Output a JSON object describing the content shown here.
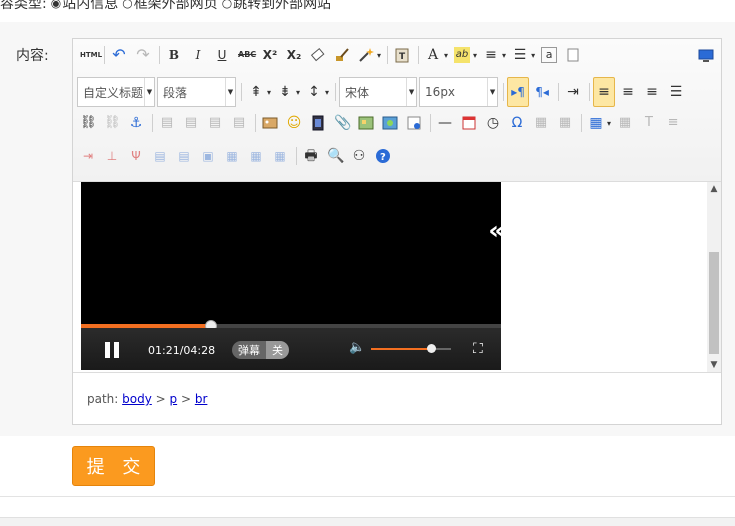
{
  "type_row": {
    "label": "容类型:",
    "options": [
      {
        "label": "站内信息",
        "selected": true
      },
      {
        "label": "框架外部网页",
        "selected": false
      },
      {
        "label": "跳转到外部网站",
        "selected": false
      }
    ]
  },
  "content_label": "内容:",
  "toolbar": {
    "row1": [
      {
        "name": "source-html-button",
        "icon": "HTML"
      },
      {
        "name": "undo-button",
        "icon": "↶"
      },
      {
        "name": "redo-button",
        "icon": "↷",
        "dim": true
      },
      {
        "name": "bold-button",
        "icon": "B"
      },
      {
        "name": "italic-button",
        "icon": "I"
      },
      {
        "name": "underline-button",
        "icon": "U"
      },
      {
        "name": "strikethrough-button",
        "icon": "ABC"
      },
      {
        "name": "superscript-button",
        "icon": "X²"
      },
      {
        "name": "subscript-button",
        "icon": "X₂"
      },
      {
        "name": "eraser-button",
        "icon": "⌫"
      },
      {
        "name": "format-brush-button",
        "icon": "🖌"
      },
      {
        "name": "auto-format-button",
        "icon": "✦"
      },
      {
        "name": "paste-plain-button",
        "icon": "▣"
      },
      {
        "name": "font-color-button",
        "icon": "A"
      },
      {
        "name": "highlight-color-button",
        "icon": "ab"
      },
      {
        "name": "ordered-list-button",
        "icon": "≡"
      },
      {
        "name": "unordered-list-button",
        "icon": "☰"
      },
      {
        "name": "select-all-button",
        "icon": "a"
      },
      {
        "name": "clear-doc-button",
        "icon": "▢"
      },
      {
        "name": "preview-button",
        "icon": "▭"
      }
    ],
    "row2": {
      "custom_title": "自定义标题",
      "paragraph": "段落",
      "font_family": "宋体",
      "font_size": "16px"
    },
    "row3": [
      "link",
      "unlink",
      "anchor",
      "image-none",
      "image-left",
      "image-right",
      "image-center",
      "simple-upload",
      "emotion",
      "insert-video",
      "attachment",
      "map",
      "gmap",
      "insert-frame",
      "horizontal-rule",
      "date",
      "time",
      "special-char",
      "snapscreen",
      "wordimage",
      "insert-table",
      "delete-table",
      "insert-paragraph-before-table"
    ],
    "row4": [
      "insert-row",
      "delete-row",
      "insert-col",
      "delete-col",
      "merge-cells",
      "merge-right",
      "merge-down",
      "split-cells",
      "split-rows",
      "split-cols",
      "print",
      "search-replace",
      "template",
      "help"
    ]
  },
  "video": {
    "time": "01:21/04:28",
    "progress": 0.31,
    "volume": 0.75,
    "danmaku_label": "弹幕",
    "danmaku_state": "关",
    "expand_icon": "«"
  },
  "pathbar": {
    "prefix": "path: ",
    "items": [
      "body",
      "p",
      "br"
    ],
    "separator": " > "
  },
  "submit_label": "提 交",
  "colors": {
    "accent": "#fb9a1f",
    "progress": "#f36f21",
    "active_button": "#fde7a3"
  }
}
